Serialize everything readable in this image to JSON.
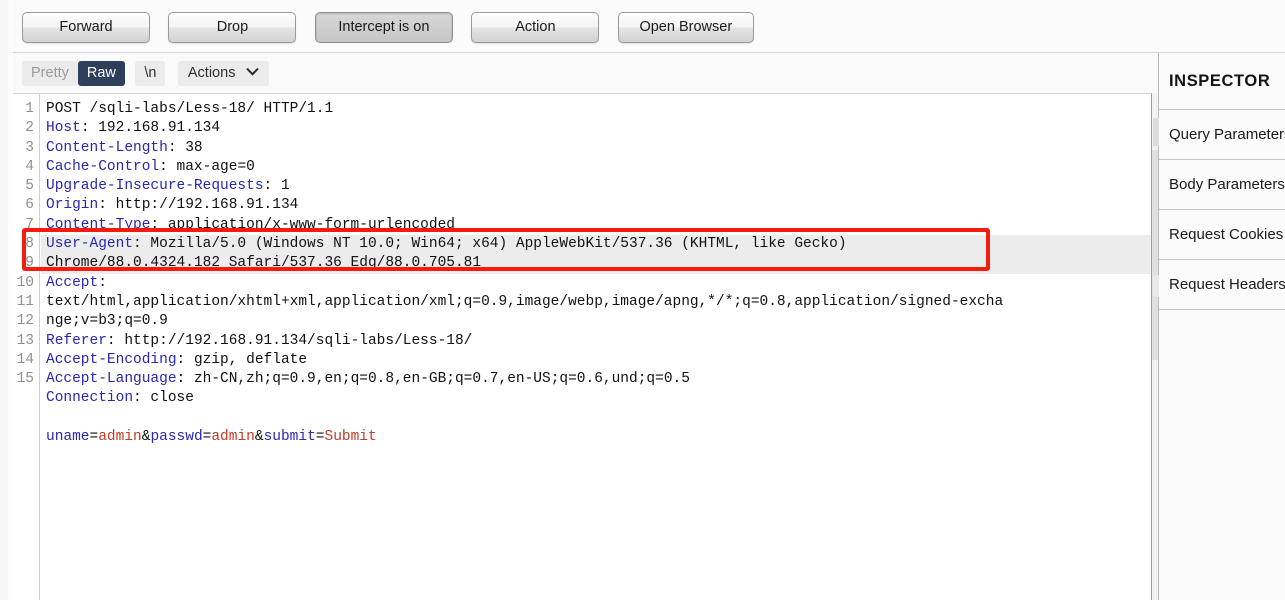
{
  "toolbar": {
    "buttons": [
      {
        "label": "Forward",
        "state": "normal"
      },
      {
        "label": "Drop",
        "state": "normal"
      },
      {
        "label": "Intercept is on",
        "state": "pressed"
      },
      {
        "label": "Action",
        "state": "normal"
      },
      {
        "label": "Open Browser",
        "state": "normal"
      }
    ]
  },
  "viewtabs": {
    "pretty": "Pretty",
    "raw": "Raw",
    "newline": "\\n",
    "actions": "Actions",
    "chevron": "chevron-down-icon",
    "active": "Raw"
  },
  "editor": {
    "line_numbers": [
      "1",
      "2",
      "3",
      "4",
      "5",
      "6",
      "7",
      "8",
      "",
      "9",
      "",
      "",
      "10",
      "11",
      "12",
      "13",
      "14",
      "15"
    ],
    "lines": [
      {
        "n": "1",
        "type": "request-line",
        "text": "POST /sqli-labs/Less-18/ HTTP/1.1"
      },
      {
        "n": "2",
        "type": "header",
        "name": "Host",
        "value": "192.168.91.134"
      },
      {
        "n": "3",
        "type": "header",
        "name": "Content-Length",
        "value": "38"
      },
      {
        "n": "4",
        "type": "header",
        "name": "Cache-Control",
        "value": "max-age=0"
      },
      {
        "n": "5",
        "type": "header",
        "name": "Upgrade-Insecure-Requests",
        "value": "1"
      },
      {
        "n": "6",
        "type": "header",
        "name": "Origin",
        "value": "http://192.168.91.134"
      },
      {
        "n": "7",
        "type": "header",
        "name": "Content-Type",
        "value": "application/x-www-form-urlencoded"
      },
      {
        "n": "8",
        "type": "header",
        "name": "User-Agent",
        "value": "Mozilla/5.0 (Windows NT 10.0; Win64; x64) AppleWebKit/537.36 (KHTML, like Gecko)",
        "highlighted": true
      },
      {
        "n": "",
        "type": "wrap",
        "text": "Chrome/88.0.4324.182 Safari/537.36 Edg/88.0.705.81",
        "highlighted": true
      },
      {
        "n": "9",
        "type": "header",
        "name": "Accept",
        "value": ""
      },
      {
        "n": "",
        "type": "wrap",
        "text": "text/html,application/xhtml+xml,application/xml;q=0.9,image/webp,image/apng,*/*;q=0.8,application/signed-excha"
      },
      {
        "n": "",
        "type": "wrap",
        "text": "nge;v=b3;q=0.9"
      },
      {
        "n": "10",
        "type": "header",
        "name": "Referer",
        "value": "http://192.168.91.134/sqli-labs/Less-18/"
      },
      {
        "n": "11",
        "type": "header",
        "name": "Accept-Encoding",
        "value": "gzip, deflate"
      },
      {
        "n": "12",
        "type": "header",
        "name": "Accept-Language",
        "value": "zh-CN,zh;q=0.9,en;q=0.8,en-GB;q=0.7,en-US;q=0.6,und;q=0.5"
      },
      {
        "n": "13",
        "type": "header",
        "name": "Connection",
        "value": "close"
      },
      {
        "n": "14",
        "type": "blank",
        "text": ""
      },
      {
        "n": "15",
        "type": "body",
        "params": [
          {
            "name": "uname",
            "value": "admin"
          },
          {
            "name": "passwd",
            "value": "admin"
          },
          {
            "name": "submit",
            "value": "Submit"
          }
        ]
      }
    ],
    "annotation": {
      "type": "red-rectangle",
      "color": "#f51c0f",
      "targets_line": "8"
    }
  },
  "inspector": {
    "title": "INSPECTOR",
    "rows": [
      {
        "label": "Query Parameters"
      },
      {
        "label": "Body Parameters"
      },
      {
        "label": "Request Cookies"
      },
      {
        "label": "Request Headers"
      }
    ]
  },
  "colors": {
    "accent_active_tab": "#2e3f5c",
    "header_name": "#2727b6",
    "param_value": "#c23b22",
    "annotation": "#f51c0f",
    "highlight_row": "#ececec"
  }
}
